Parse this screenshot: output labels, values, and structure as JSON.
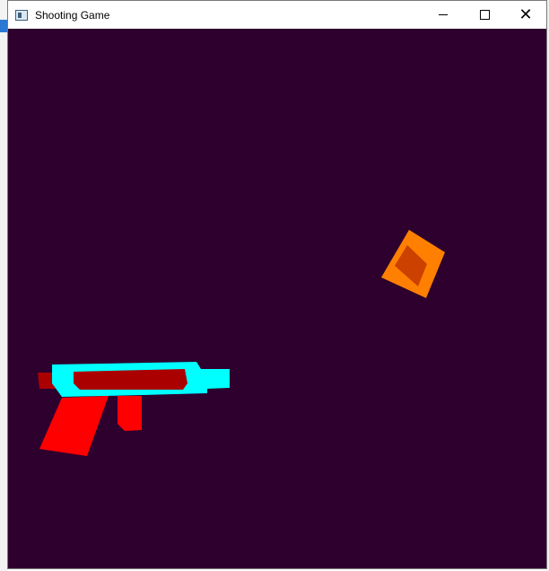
{
  "window": {
    "title": "Shooting Game",
    "icon": "app-window-icon",
    "controls": {
      "minimize": "minimize-icon",
      "maximize": "maximize-icon",
      "close": "close-icon",
      "close_glyph": "✕"
    }
  },
  "game": {
    "background_color": "#2e002e",
    "gun": {
      "frame_color": "#00ffff",
      "barrel_color": "#aa0000",
      "grip_color": "#ff0000"
    },
    "target": {
      "outer_color": "#ff8000",
      "inner_color": "#cc4000"
    }
  }
}
